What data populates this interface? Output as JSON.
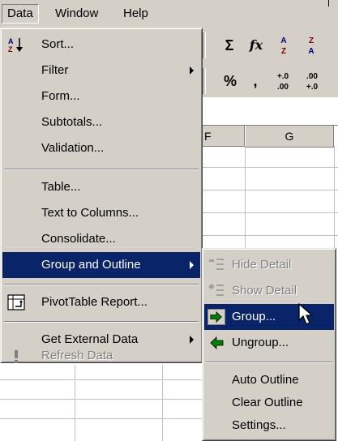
{
  "menubar": {
    "data": "Data",
    "window": "Window",
    "help": "Help"
  },
  "toolbar": {
    "sum_symbol": "Σ",
    "function_symbol": "fx",
    "sort_asc_top": "A",
    "sort_asc_bottom": "Z",
    "sort_desc_top": "Z",
    "sort_desc_bottom": "A",
    "percent_symbol": "%",
    "comma_symbol": ",",
    "increase_decimal_top": "+.0",
    "increase_decimal_bottom": ".00",
    "decrease_decimal_top": ".00",
    "decrease_decimal_bottom": "+.0"
  },
  "sheet": {
    "col_f": "F",
    "col_g": "G"
  },
  "data_menu": {
    "sort": "Sort...",
    "filter": "Filter",
    "form": "Form...",
    "subtotals": "Subtotals...",
    "validation": "Validation...",
    "table": "Table...",
    "text_to_columns": "Text to Columns...",
    "consolidate": "Consolidate...",
    "group_and_outline": "Group and Outline",
    "pivottable_report": "PivotTable Report...",
    "get_external_data": "Get External Data",
    "refresh_data": "Refresh Data"
  },
  "outline_menu": {
    "hide_detail": "Hide Detail",
    "show_detail": "Show Detail",
    "group": "Group...",
    "ungroup": "Ungroup...",
    "auto_outline": "Auto Outline",
    "clear_outline": "Clear Outline",
    "settings": "Settings..."
  },
  "colors": {
    "menu_face": "#d4d0c8",
    "highlight": "#0a246a",
    "disabled_text": "#808080",
    "arrow_green": "#008000"
  }
}
